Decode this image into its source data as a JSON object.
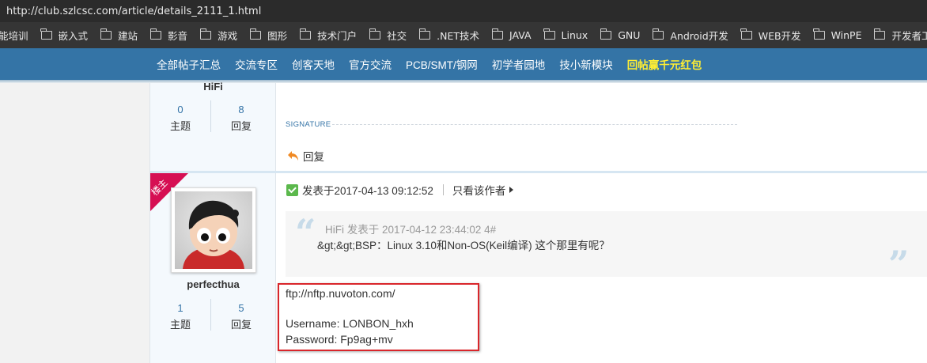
{
  "browser": {
    "url": "http://club.szlcsc.com/article/details_2111_1.html",
    "bookmarks": [
      {
        "label": "能培训",
        "has_icon": false
      },
      {
        "label": "嵌入式",
        "has_icon": true
      },
      {
        "label": "建站",
        "has_icon": true
      },
      {
        "label": "影音",
        "has_icon": true
      },
      {
        "label": "游戏",
        "has_icon": true
      },
      {
        "label": "图形",
        "has_icon": true
      },
      {
        "label": "技术门户",
        "has_icon": true
      },
      {
        "label": "社交",
        "has_icon": true
      },
      {
        "label": ".NET技术",
        "has_icon": true
      },
      {
        "label": "JAVA",
        "has_icon": true
      },
      {
        "label": "Linux",
        "has_icon": true
      },
      {
        "label": "GNU",
        "has_icon": true
      },
      {
        "label": "Android开发",
        "has_icon": true
      },
      {
        "label": "WEB开发",
        "has_icon": true
      },
      {
        "label": "WinPE",
        "has_icon": true
      },
      {
        "label": "开发者工具",
        "has_icon": true
      }
    ]
  },
  "nav": {
    "items": [
      {
        "label": "全部帖子汇总"
      },
      {
        "label": "交流专区"
      },
      {
        "label": "创客天地"
      },
      {
        "label": "官方交流"
      },
      {
        "label": "PCB/SMT/钢网"
      },
      {
        "label": "初学者园地"
      },
      {
        "label": "技小新模块"
      },
      {
        "label": "回帖赢千元红包",
        "highlight": true
      }
    ]
  },
  "prev_post": {
    "author": "HiFi",
    "topics": {
      "value": "0",
      "label": "主题"
    },
    "replies": {
      "value": "8",
      "label": "回复"
    },
    "signature_label": "SIGNATURE",
    "reply_label": "回复"
  },
  "post": {
    "badge": "楼主",
    "author": "perfecthua",
    "topics": {
      "value": "1",
      "label": "主题"
    },
    "replies": {
      "value": "5",
      "label": "回复"
    },
    "posted_at": "发表于2017-04-13 09:12:52",
    "only_author": "只看该作者",
    "quote": {
      "meta": "HiFi 发表于 2017-04-12 23:44:02  4#",
      "text": "&gt;&gt;BSP：Linux 3.10和Non-OS(Keil编译)   这个那里有呢？"
    },
    "content": {
      "line1": "ftp://nftp.nuvoton.com/",
      "line2": "Username: LONBON_hxh",
      "line3": "Password: Fp9ag+mv"
    }
  },
  "colors": {
    "nav_bg": "#3474a6",
    "nav_highlight": "#ffee33",
    "badge": "#d60f53",
    "accent": "#3574a7",
    "highlight_border": "#d9262b"
  },
  "icons": [
    "folder-icon",
    "reply-arrow-icon",
    "post-status-icon",
    "triangle-right-icon",
    "quote-open-icon",
    "quote-close-icon",
    "avatar"
  ]
}
